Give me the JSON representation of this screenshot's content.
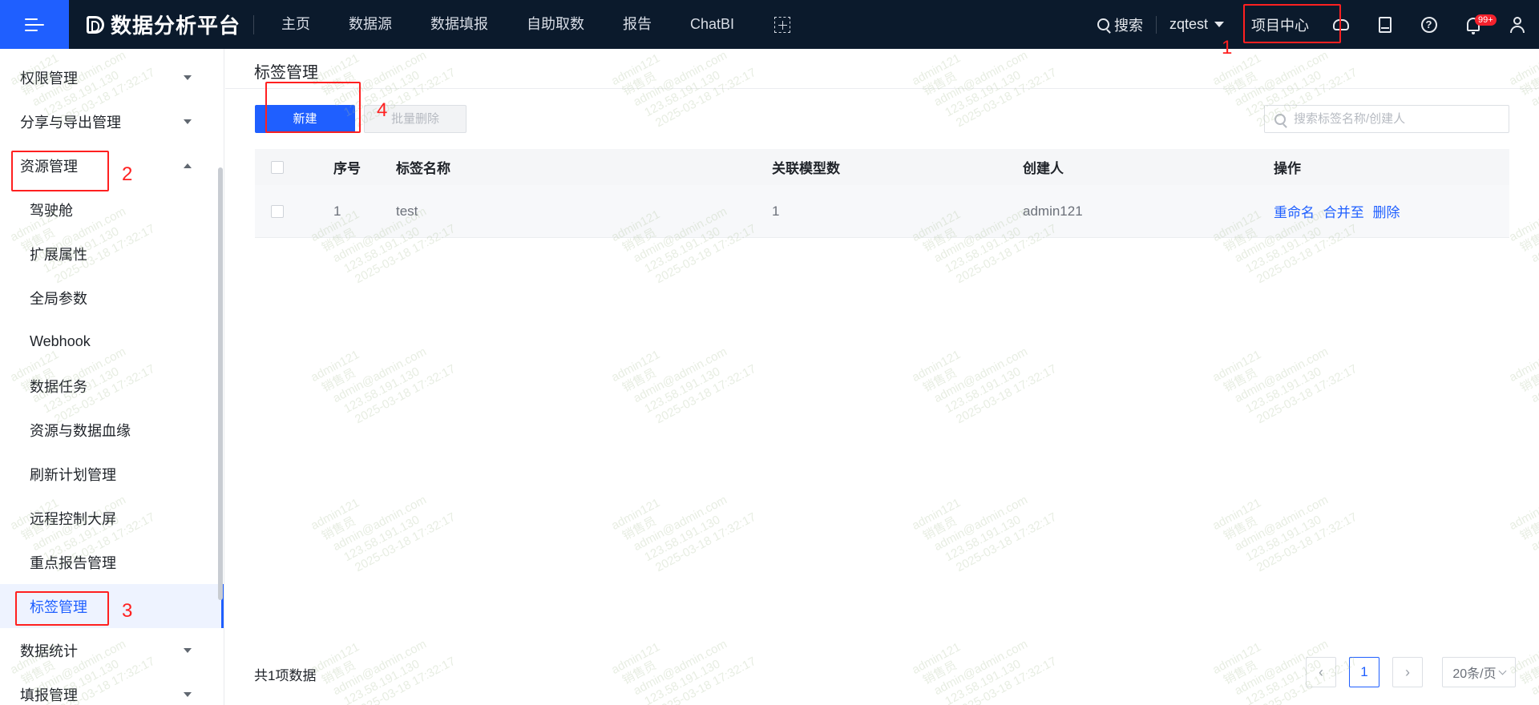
{
  "app": {
    "title": "数据分析平台"
  },
  "topnav": {
    "items": [
      "主页",
      "数据源",
      "数据填报",
      "自助取数",
      "报告",
      "ChatBI"
    ],
    "search_label": "搜索",
    "user": "zqtest",
    "project_center": "项目中心",
    "notification_badge": "99+"
  },
  "sidebar": {
    "groups_top": [
      {
        "label": "权限管理",
        "state": "collapsed"
      },
      {
        "label": "分享与导出管理",
        "state": "collapsed"
      },
      {
        "label": "资源管理",
        "state": "expanded"
      }
    ],
    "items": [
      "驾驶舱",
      "扩展属性",
      "全局参数",
      "Webhook",
      "数据任务",
      "资源与数据血缘",
      "刷新计划管理",
      "远程控制大屏",
      "重点报告管理",
      "标签管理"
    ],
    "active_item": "标签管理",
    "groups_bottom": [
      {
        "label": "数据统计",
        "state": "collapsed"
      },
      {
        "label": "填报管理",
        "state": "collapsed"
      }
    ]
  },
  "main": {
    "page_title": "标签管理",
    "new_button": "新建",
    "batch_delete_button": "批量删除",
    "search_placeholder": "搜索标签名称/创建人",
    "table": {
      "columns": [
        "序号",
        "标签名称",
        "关联模型数",
        "创建人",
        "操作"
      ],
      "rows": [
        {
          "index": "1",
          "name": "test",
          "model_count": "1",
          "creator": "admin121",
          "ops": [
            "重命名",
            "合并至",
            "删除"
          ]
        }
      ]
    },
    "total_text": "共1项数据",
    "pagination": {
      "current_page": "1",
      "page_size": "20条/页"
    }
  },
  "annotations": [
    "1",
    "2",
    "3",
    "4"
  ],
  "watermark": {
    "lines": [
      "admin121",
      "销售员",
      "admin@admin.com",
      "123.58.191.130",
      "2025-03-18 17:32:17"
    ]
  },
  "colors": {
    "topbar_bg": "#0b1a2c",
    "accent": "#1f5fff",
    "annotation_red": "#ff2020",
    "badge_red": "#f5222d"
  }
}
